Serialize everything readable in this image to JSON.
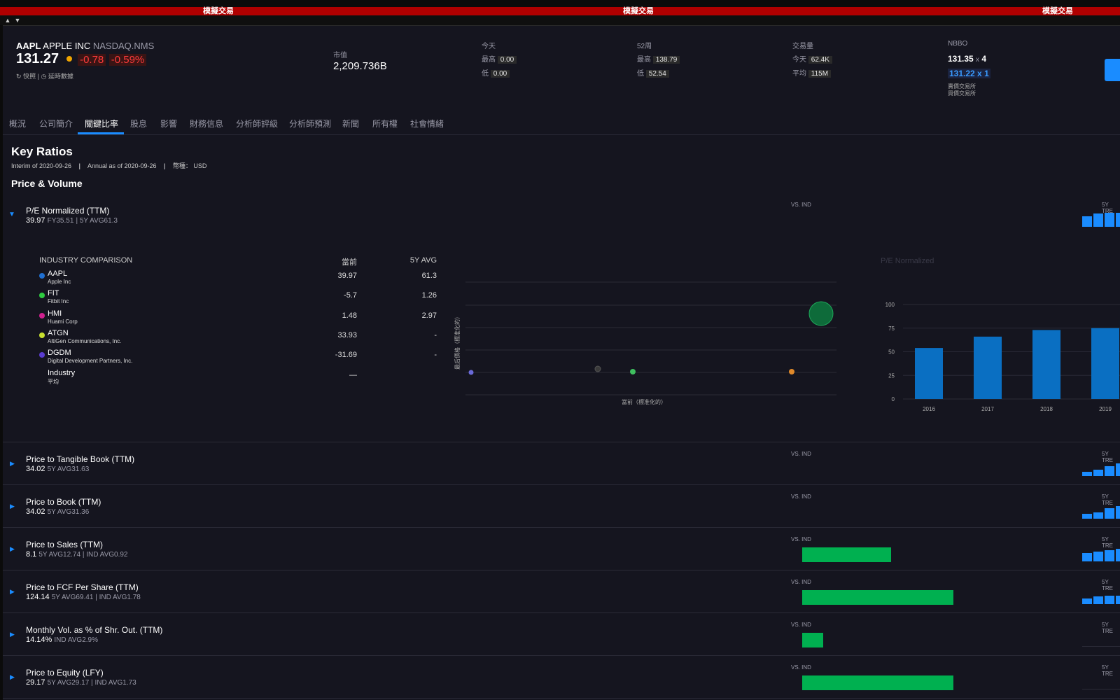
{
  "sim": {
    "label": "模擬交易"
  },
  "quote": {
    "symbol": "AAPL",
    "name": "APPLE INC",
    "exchange": "NASDAQ.NMS",
    "price": "131.27",
    "change": "-0.78",
    "change_pct": "-0.59%",
    "snapshot": "快照",
    "delayed": "延時數據",
    "mktcap_label": "市值",
    "mktcap": "2,209.736B",
    "today_label": "今天",
    "high_label": "最高",
    "low_label": "低",
    "today_high": "0.00",
    "today_low": "0.00",
    "wk52_label": "52周",
    "wk52_high": "138.79",
    "wk52_low": "52.54",
    "vol_label": "交易量",
    "vol_today_label": "今天",
    "vol_today": "62.4K",
    "vol_avg_label": "平均",
    "vol_avg": "115M",
    "nbbo_label": "NBBO",
    "bid": "131.35",
    "bid_size": "4",
    "ask": "131.22",
    "ask_size": "1",
    "bid_ex": "賣價交易所",
    "ask_ex": "買價交易所",
    "x": "x"
  },
  "tabs": [
    "概況",
    "公司簡介",
    "關鍵比率",
    "股息",
    "影響",
    "財務信息",
    "分析師評級",
    "分析師預測",
    "新聞",
    "所有權",
    "社會情緒"
  ],
  "page": {
    "title": "Key Ratios",
    "interim": "Interim of 2020-09-26",
    "annual": "Annual as of 2020-09-26",
    "currency": "幣種： USD",
    "section": "Price & Volume",
    "vs_ind": "VS. IND",
    "trend": "5Y TRE"
  },
  "pe": {
    "title": "P/E Normalized (TTM)",
    "value": "39.97",
    "fy": "FY35.51",
    "avg": "5Y AVG61.3"
  },
  "industry": {
    "header": "INDUSTRY COMPARISON",
    "col_cur": "當前",
    "col_avg": "5Y AVG",
    "rows": [
      {
        "ticker": "AAPL",
        "name": "Apple Inc",
        "cur": "39.97",
        "avg": "61.3",
        "color": "#1f6fd1"
      },
      {
        "ticker": "FIT",
        "name": "Fitbit Inc",
        "cur": "-5.7",
        "avg": "1.26",
        "color": "#2ecc40"
      },
      {
        "ticker": "HMI",
        "name": "Huami Corp",
        "cur": "1.48",
        "avg": "2.97",
        "color": "#d0208f"
      },
      {
        "ticker": "ATGN",
        "name": "AltiGen Communications, Inc.",
        "cur": "33.93",
        "avg": "-",
        "color": "#c8e030"
      },
      {
        "ticker": "DGDM",
        "name": "Digital Development Partners, Inc.",
        "cur": "-31.69",
        "avg": "-",
        "color": "#5a3cd0"
      },
      {
        "ticker": "Industry",
        "name": "平均",
        "cur": "—",
        "avg": "",
        "color": ""
      }
    ]
  },
  "scatter": {
    "xlabel": "當前（標准化的）",
    "ylabel": "最后價格（標准化的）"
  },
  "chart_data": {
    "type": "bar",
    "title": "P/E Normalized",
    "categories": [
      "2016",
      "2017",
      "2018",
      "2019"
    ],
    "values": [
      54,
      66,
      73,
      75
    ],
    "ylim": [
      0,
      100
    ],
    "yticks": [
      "0",
      "25",
      "50",
      "75",
      "100"
    ]
  },
  "ratios": [
    {
      "title": "Price to Tangible Book (TTM)",
      "value": "34.02",
      "parts": [
        "5Y AVG31.63"
      ],
      "vs": 0,
      "trend": [
        0.35,
        0.5,
        0.8,
        1
      ]
    },
    {
      "title": "Price to Book (TTM)",
      "value": "34.02",
      "parts": [
        "5Y AVG31.36"
      ],
      "vs": 0,
      "trend": [
        0.4,
        0.5,
        0.85,
        1
      ]
    },
    {
      "title": "Price to Sales (TTM)",
      "value": "8.1",
      "parts": [
        "5Y AVG12.74",
        "IND AVG0.92"
      ],
      "vs": 0.59,
      "trend": [
        0.65,
        0.8,
        0.9,
        1
      ]
    },
    {
      "title": "Price to FCF Per Share (TTM)",
      "value": "124.14",
      "parts": [
        "5Y AVG69.41",
        "IND AVG1.78"
      ],
      "vs": 1.0,
      "trend": [
        0.45,
        0.6,
        0.65,
        0.65
      ]
    },
    {
      "title": "Monthly Vol. as % of Shr. Out. (TTM)",
      "value": "14.14%",
      "parts": [
        "IND AVG2.9%"
      ],
      "vs": 0.14,
      "trend": [
        0,
        0,
        0,
        0
      ]
    },
    {
      "title": "Price to Equity (LFY)",
      "value": "29.17",
      "parts": [
        "5Y AVG29.17",
        "IND AVG1.73"
      ],
      "vs": 1.0,
      "trend": [
        0,
        0,
        0,
        0
      ]
    }
  ]
}
